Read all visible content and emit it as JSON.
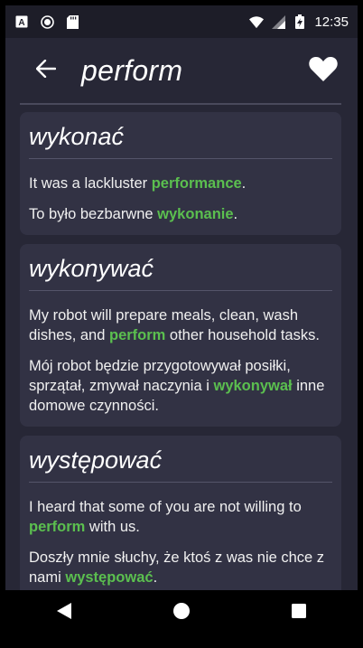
{
  "status_bar": {
    "time": "12:35",
    "icons_left": [
      "notification-a-icon",
      "record-icon",
      "sd-card-icon"
    ],
    "icons_right": [
      "wifi-icon",
      "cellular-icon",
      "battery-charging-icon"
    ]
  },
  "app_bar": {
    "title": "perform",
    "back_icon": "arrow-back-icon",
    "favorite_icon": "heart-icon"
  },
  "cards": [
    {
      "title": "wykonać",
      "examples": [
        {
          "before": "It was a lackluster ",
          "highlight": "performance",
          "after": "."
        },
        {
          "before": "To było bezbarwne ",
          "highlight": "wykonanie",
          "after": "."
        }
      ]
    },
    {
      "title": "wykonywać",
      "examples": [
        {
          "before": "My robot will prepare meals, clean, wash dishes, and ",
          "highlight": "perform",
          "after": " other household tasks."
        },
        {
          "before": "Mój robot będzie przygotowywał posiłki, sprzątał, zmywał naczynia i ",
          "highlight": "wykonywał",
          "after": " inne domowe czynności."
        }
      ]
    },
    {
      "title": "występować",
      "examples": [
        {
          "before": "I heard that some of you are not willing to ",
          "highlight": "perform",
          "after": " with us."
        },
        {
          "before": "Doszły mnie słuchy, że ktoś z was nie chce z nami ",
          "highlight": "występować",
          "after": "."
        }
      ]
    }
  ],
  "nav_bar": {
    "buttons": [
      "back-triangle-icon",
      "home-circle-icon",
      "recents-square-icon"
    ]
  },
  "colors": {
    "background": "#272736",
    "card": "#323244",
    "highlight": "#5bbf4f"
  }
}
